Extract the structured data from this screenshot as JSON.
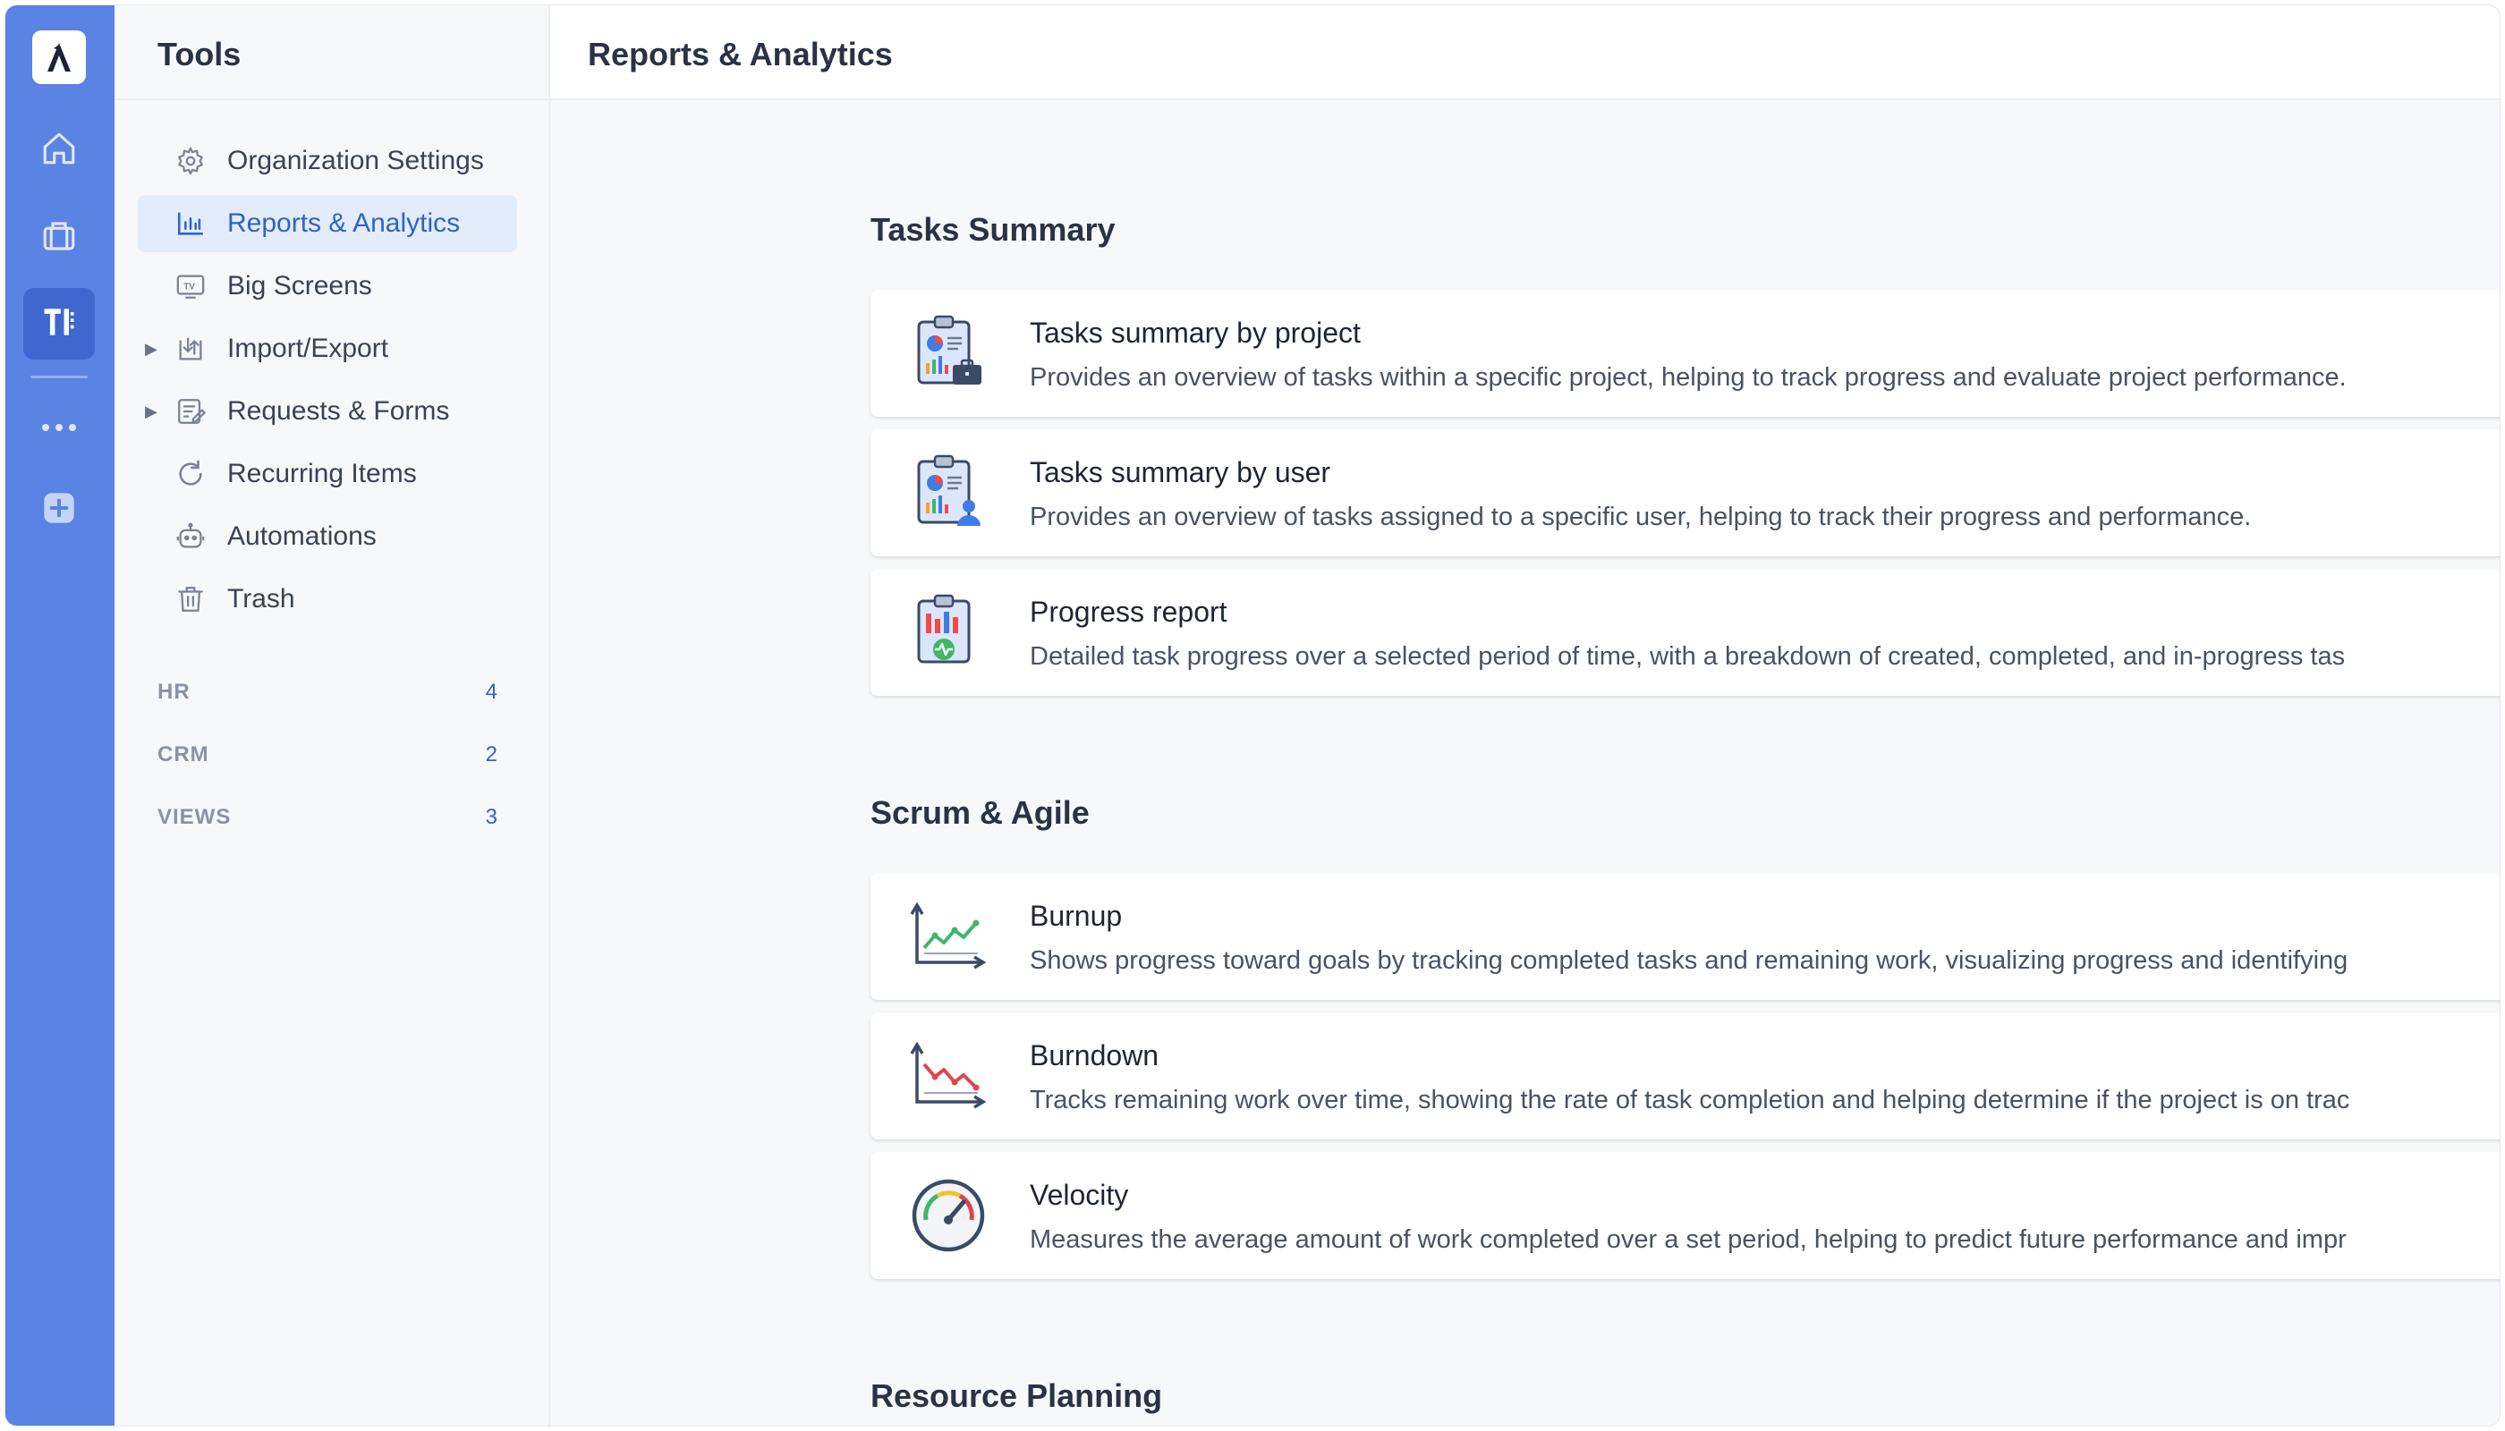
{
  "rail": {
    "items": [
      "home-icon",
      "briefcase-icon",
      "tools-icon",
      "more-icon",
      "add-icon"
    ],
    "active": "tools-icon"
  },
  "tools": {
    "title": "Tools",
    "items": [
      {
        "label": "Organization Settings",
        "icon": "gear-icon"
      },
      {
        "label": "Reports & Analytics",
        "icon": "bar-chart-icon",
        "active": true
      },
      {
        "label": "Big Screens",
        "icon": "tv-icon"
      },
      {
        "label": "Import/Export",
        "icon": "import-export-icon",
        "expandable": true
      },
      {
        "label": "Requests & Forms",
        "icon": "form-icon",
        "expandable": true
      },
      {
        "label": "Recurring Items",
        "icon": "recurring-icon"
      },
      {
        "label": "Automations",
        "icon": "robot-icon"
      },
      {
        "label": "Trash",
        "icon": "trash-icon"
      }
    ],
    "groups": [
      {
        "label": "HR",
        "count": "4"
      },
      {
        "label": "CRM",
        "count": "2"
      },
      {
        "label": "VIEWS",
        "count": "3"
      }
    ]
  },
  "main": {
    "title": "Reports & Analytics",
    "sections": [
      {
        "title": "Tasks Summary",
        "cards": [
          {
            "title": "Tasks summary by project",
            "desc": "Provides an overview of tasks within a specific project, helping to track progress and evaluate project performance."
          },
          {
            "title": "Tasks summary by user",
            "desc": "Provides an overview of tasks assigned to a specific user, helping to track their progress and performance."
          },
          {
            "title": "Progress report",
            "desc": "Detailed task progress over a selected period of time, with a breakdown of created, completed, and in-progress tas"
          }
        ]
      },
      {
        "title": "Scrum & Agile",
        "cards": [
          {
            "title": "Burnup",
            "desc": "Shows progress toward goals by tracking completed tasks and remaining work, visualizing progress and identifying"
          },
          {
            "title": "Burndown",
            "desc": "Tracks remaining work over time, showing the rate of task completion and helping determine if the project is on trac"
          },
          {
            "title": "Velocity",
            "desc": "Measures the average amount of work completed over a set period, helping to predict future performance and impr"
          }
        ]
      },
      {
        "title": "Resource Planning",
        "cards": []
      }
    ]
  },
  "colors": {
    "rail": "#5b83e3",
    "accent": "#2f63c9",
    "active_bg": "#e3ecfb"
  }
}
